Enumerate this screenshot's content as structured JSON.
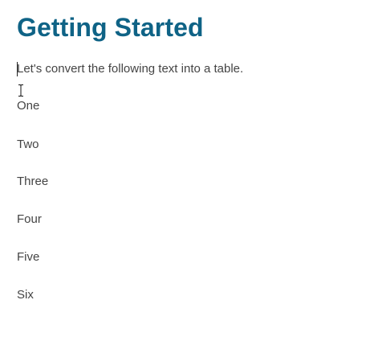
{
  "document": {
    "heading": "Getting Started",
    "intro": "Let's convert the following text into a table.",
    "lines": [
      "One",
      "Two",
      "Three",
      "Four",
      "Five",
      "Six"
    ]
  },
  "colors": {
    "heading": "#0f6386",
    "body_text": "#444444",
    "background": "#ffffff"
  },
  "icons": {
    "mouse_cursor": "i-beam-cursor-icon"
  }
}
